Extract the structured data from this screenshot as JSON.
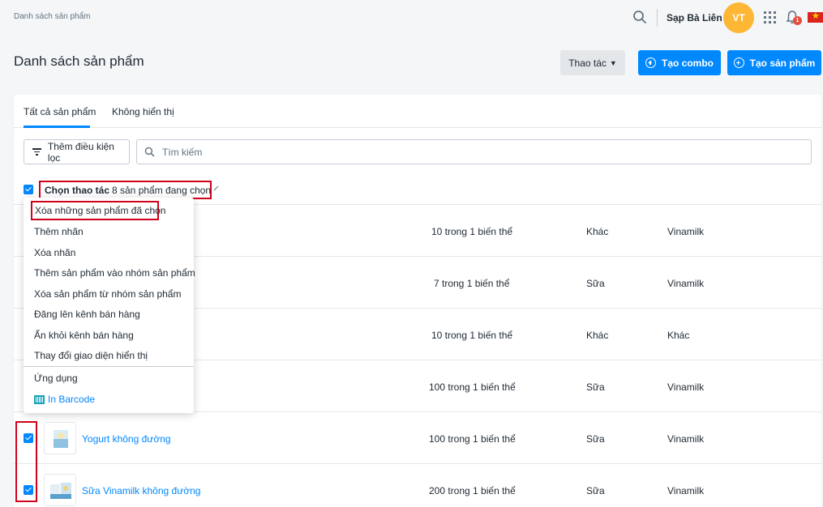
{
  "header": {
    "breadcrumb": "Danh sách sản phẩm",
    "store_name": "Sạp Bà Liên",
    "avatar_initials": "VT",
    "notification_count": "1"
  },
  "page": {
    "title": "Danh sách sản phẩm",
    "actions_label": "Thao tác",
    "create_combo_label": "Tạo combo",
    "create_product_label": "Tạo sản phẩm"
  },
  "tabs": [
    {
      "label": "Tất cả sản phẩm",
      "active": true
    },
    {
      "label": "Không hiển thị",
      "active": false
    }
  ],
  "filter": {
    "add_filter_label": "Thêm điều kiện lọc",
    "search_placeholder": "Tìm kiếm"
  },
  "bulk": {
    "label": "Chọn thao tác",
    "selection_text": "8 sản phẩm đang chọn"
  },
  "bulk_menu": {
    "items": [
      "Xóa những sản phẩm đã chọn",
      "Thêm nhãn",
      "Xóa nhãn",
      "Thêm sản phẩm vào nhóm sản phẩm",
      "Xóa sản phẩm từ nhóm sản phẩm",
      "Đăng lên kênh bán hàng",
      "Ẩn khỏi kênh bán hàng",
      "Thay đổi giao diện hiển thị"
    ],
    "apps_label": "Ứng dụng",
    "barcode_label": "In Barcode"
  },
  "rows": [
    {
      "name": "",
      "variants": "10 trong 1 biến thể",
      "type": "Khác",
      "brand": "Vinamilk"
    },
    {
      "name": "",
      "variants": "7 trong 1 biến thể",
      "type": "Sữa",
      "brand": "Vinamilk"
    },
    {
      "name": "",
      "variants": "10 trong 1 biến thể",
      "type": "Khác",
      "brand": "Khác"
    },
    {
      "name": "",
      "variants": "100 trong 1 biến thể",
      "type": "Sữa",
      "brand": "Vinamilk"
    },
    {
      "name": "Yogurt không đường",
      "variants": "100 trong 1 biến thể",
      "type": "Sữa",
      "brand": "Vinamilk"
    },
    {
      "name": "Sữa Vinamilk không đường",
      "variants": "200 trong 1 biến thể",
      "type": "Sữa",
      "brand": "Vinamilk"
    }
  ],
  "colors": {
    "primary": "#0088ff",
    "highlight": "#d0021b",
    "avatar": "#fdb735"
  }
}
